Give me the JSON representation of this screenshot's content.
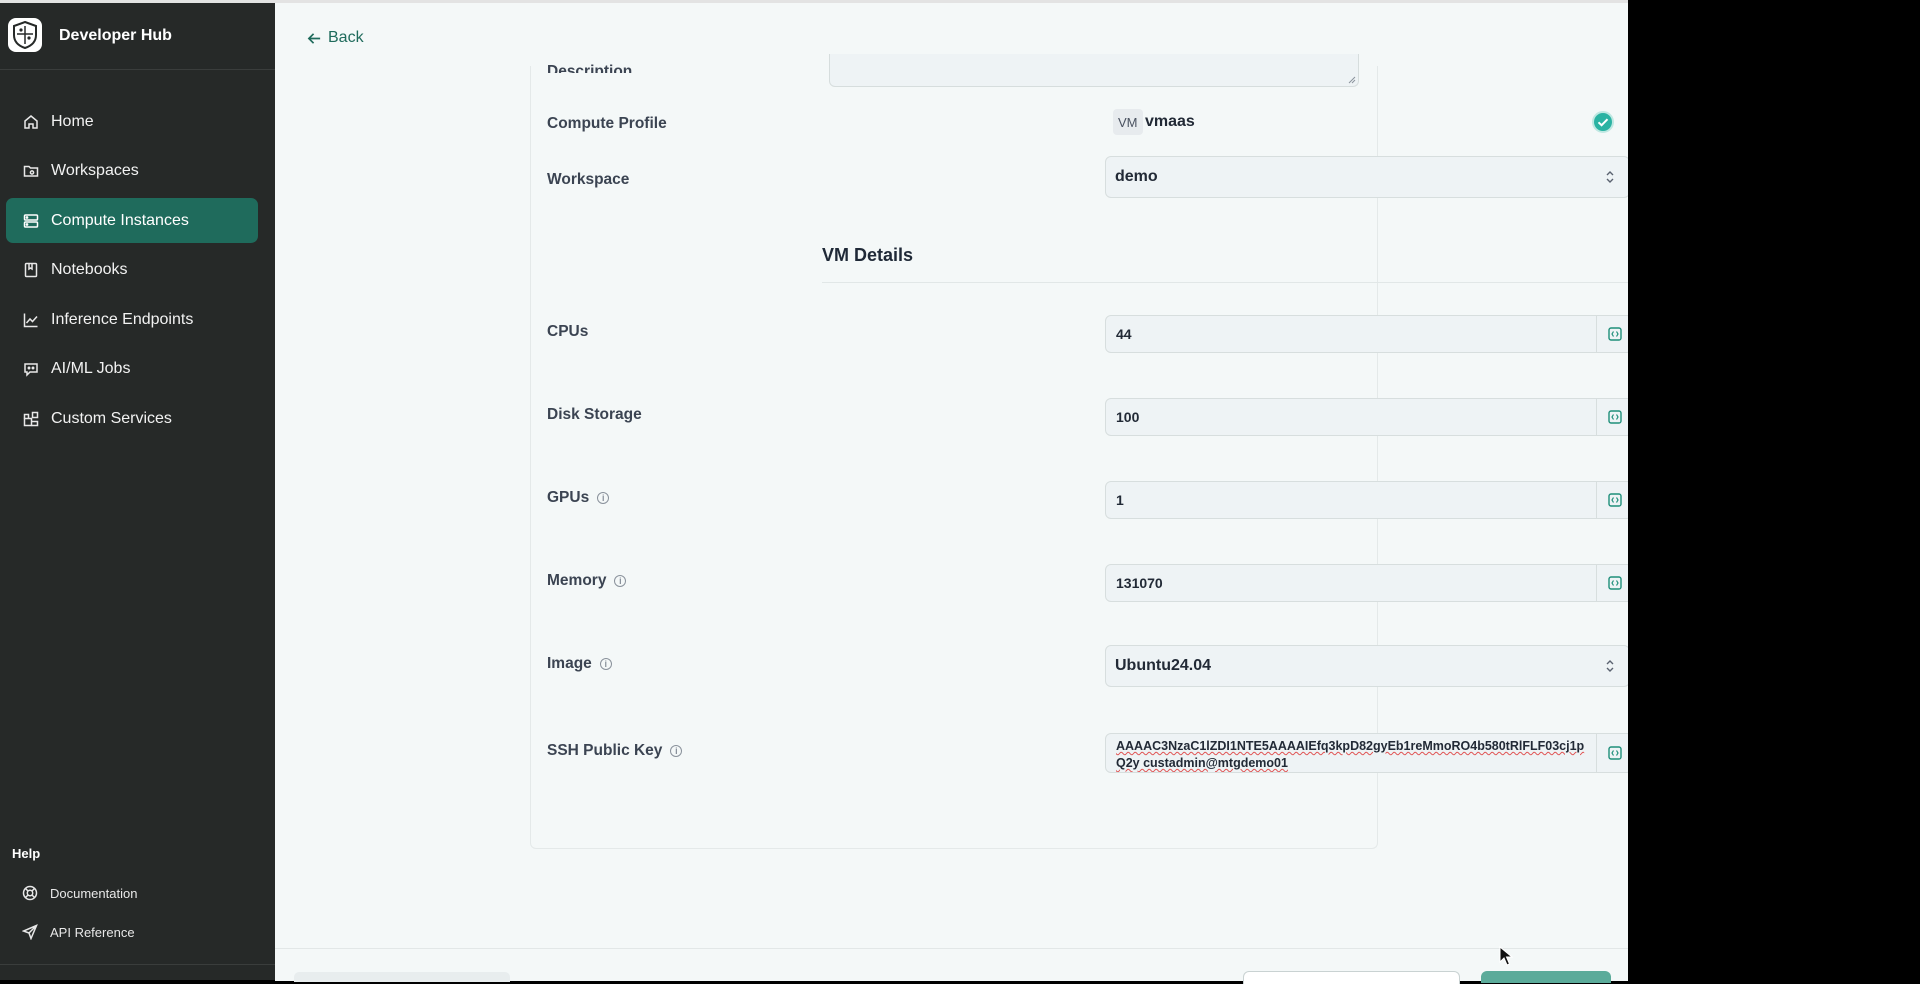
{
  "sidebar": {
    "app_title": "Developer Hub",
    "nav": [
      {
        "label": "Home",
        "icon": "home-icon"
      },
      {
        "label": "Workspaces",
        "icon": "folder-icon"
      },
      {
        "label": "Compute Instances",
        "icon": "server-icon",
        "active": true
      },
      {
        "label": "Notebooks",
        "icon": "notebook-icon"
      },
      {
        "label": "Inference Endpoints",
        "icon": "chart-line-icon"
      },
      {
        "label": "AI/ML Jobs",
        "icon": "bot-icon"
      },
      {
        "label": "Custom Services",
        "icon": "blocks-icon"
      }
    ],
    "help": {
      "title": "Help",
      "items": [
        {
          "label": "Documentation",
          "icon": "lifebuoy-icon"
        },
        {
          "label": "API Reference",
          "icon": "send-icon"
        }
      ]
    }
  },
  "main": {
    "back_label": "Back",
    "form": {
      "description_label": "Description",
      "compute_profile_label": "Compute Profile",
      "compute_profile_badge": "VM",
      "compute_profile_value": "vmaas",
      "workspace_label": "Workspace",
      "workspace_value": "demo",
      "section_title": "VM Details",
      "cpus_label": "CPUs",
      "cpus_value": "44",
      "disk_label": "Disk Storage",
      "disk_value": "100",
      "gpus_label": "GPUs",
      "gpus_value": "1",
      "memory_label": "Memory",
      "memory_value": "131070",
      "image_label": "Image",
      "image_value": "Ubuntu24.04",
      "ssh_label": "SSH Public Key",
      "ssh_line1": "AAAAC3NzaC1lZDI1NTE5AAAAIEfq3kpD82gyEb1reMmoRO4b580tRlFLF03cj1p",
      "ssh_line2": "Q2y custadmin@mtgdemo01"
    }
  },
  "colors": {
    "accent": "#1f6b5c",
    "sidebar_bg": "#262928",
    "page_bg": "#f4f8f8",
    "check": "#2bb3a3"
  }
}
